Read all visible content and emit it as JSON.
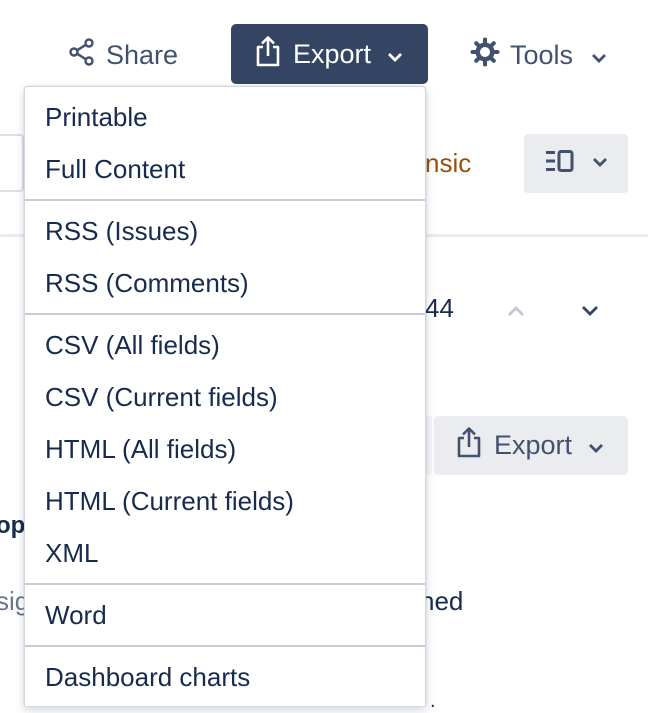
{
  "toolbar": {
    "share_label": "Share",
    "export_label": "Export",
    "tools_label": "Tools"
  },
  "background": {
    "partial_label": "nsic",
    "count_fragment": "44",
    "export_label": "Export",
    "bold_fragment": "op",
    "gray_fragment": "sig",
    "text_fragment": "ned",
    "dot_fragment": "."
  },
  "export_menu": {
    "groups": [
      {
        "items": [
          {
            "label": "Printable"
          },
          {
            "label": "Full Content"
          }
        ]
      },
      {
        "items": [
          {
            "label": "RSS (Issues)"
          },
          {
            "label": "RSS (Comments)"
          }
        ]
      },
      {
        "items": [
          {
            "label": "CSV (All fields)"
          },
          {
            "label": "CSV (Current fields)"
          },
          {
            "label": "HTML (All fields)"
          },
          {
            "label": "HTML (Current fields)"
          },
          {
            "label": "XML"
          }
        ]
      },
      {
        "items": [
          {
            "label": "Word"
          }
        ]
      },
      {
        "items": [
          {
            "label": "Dashboard charts"
          }
        ]
      }
    ]
  },
  "colors": {
    "export_button_bg": "#344563",
    "toolbar_text": "#42526e",
    "menu_text": "#172b4d",
    "accent_brown": "#974f0c"
  }
}
